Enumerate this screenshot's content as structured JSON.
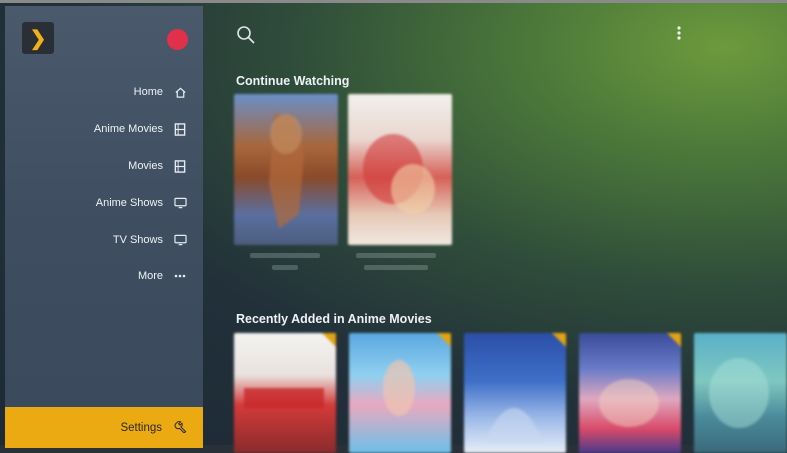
{
  "sidebar": {
    "logo_glyph": "❯",
    "items": [
      {
        "label": "Home",
        "icon": "home-icon"
      },
      {
        "label": "Anime Movies",
        "icon": "film-icon"
      },
      {
        "label": "Movies",
        "icon": "film-icon"
      },
      {
        "label": "Anime Shows",
        "icon": "tv-icon"
      },
      {
        "label": "TV Shows",
        "icon": "tv-icon"
      },
      {
        "label": "More",
        "icon": "ellipsis-icon"
      }
    ],
    "settings_label": "Settings"
  },
  "sections": {
    "continue_watching": "Continue Watching",
    "recently_added": "Recently Added in Anime Movies"
  },
  "colors": {
    "accent": "#ecaa12",
    "avatar": "#e0304a",
    "sidebar_bg": "#435366"
  }
}
